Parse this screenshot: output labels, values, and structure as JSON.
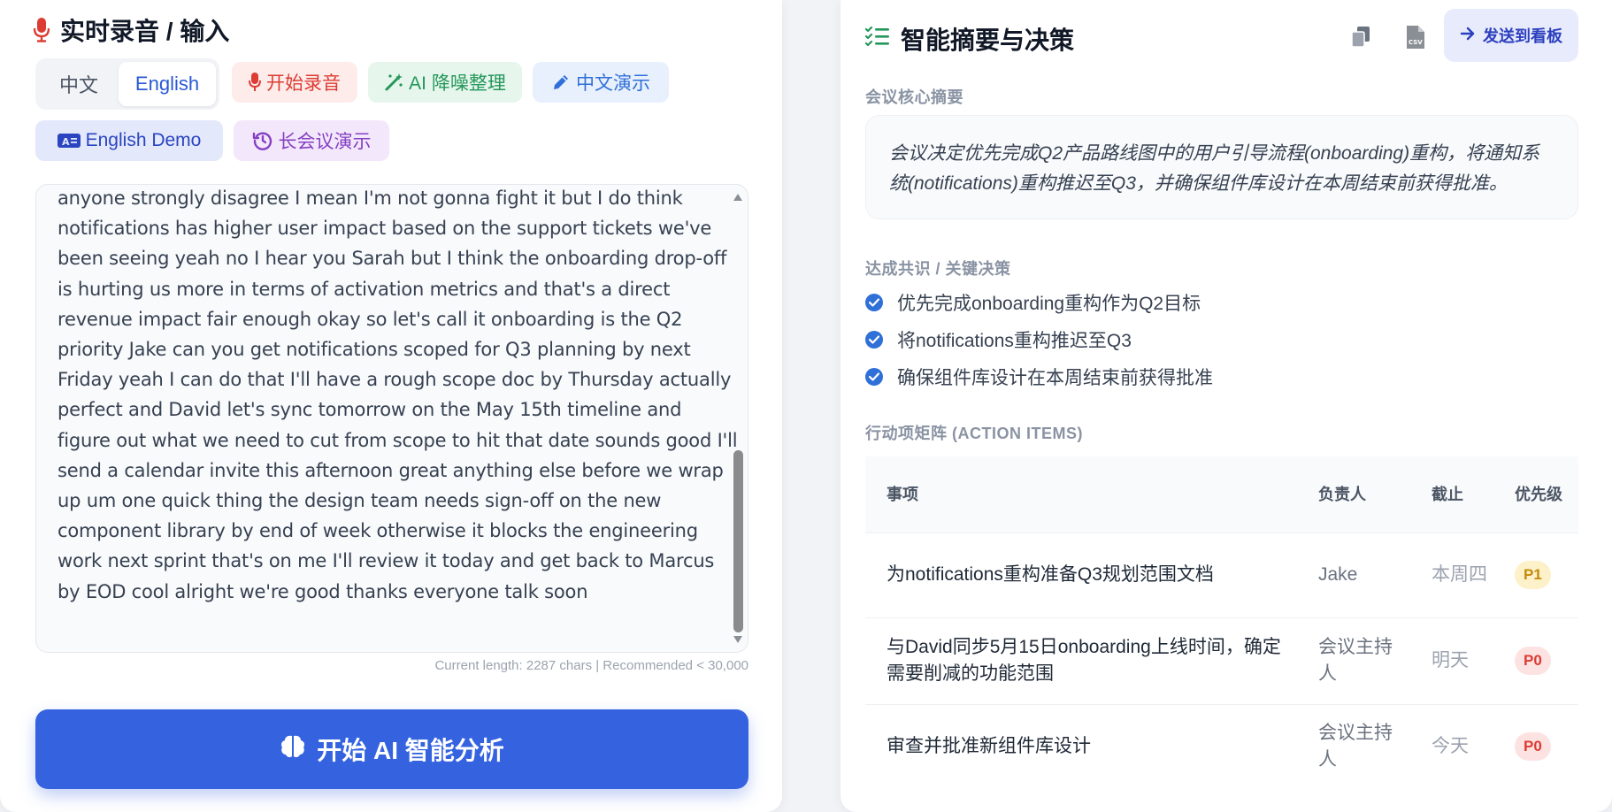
{
  "left": {
    "title": "实时录音 / 输入",
    "lang_toggle": {
      "zh": "中文",
      "en": "English",
      "selected": "English"
    },
    "buttons": {
      "record": "开始录音",
      "denoise": "AI 降噪整理",
      "zh_demo": "中文演示",
      "en_demo": "English Demo",
      "long_demo": "长会议演示"
    },
    "transcript": "anyone strongly disagree I mean I'm not gonna fight it but I do think notifications has higher user impact based on the support tickets we've been seeing yeah no I hear you Sarah but I think the onboarding drop-off is hurting us more in terms of activation metrics and that's a direct revenue impact fair enough okay so let's call it onboarding is the Q2 priority Jake can you get notifications scoped for Q3 planning by next Friday yeah I can do that I'll have a rough scope doc by Thursday actually perfect and David let's sync tomorrow on the May 15th timeline and figure out what we need to cut from scope to hit that date sounds good I'll send a calendar invite this afternoon great anything else before we wrap up um one quick thing the design team needs sign-off on the new component library by end of week otherwise it blocks the engineering work next sprint that's on me I'll review it today and get back to Marcus by EOD cool alright we're good thanks everyone talk soon",
    "char_count": "Current length: 2287 chars | Recommended < 30,000",
    "analyze_button": "开始 AI 智能分析"
  },
  "right": {
    "title": "智能摘要与决策",
    "send_button": "发送到看板",
    "summary_label": "会议核心摘要",
    "summary_text": "会议决定优先完成Q2产品路线图中的用户引导流程(onboarding)重构，将通知系统(notifications)重构推迟至Q3，并确保组件库设计在本周结束前获得批准。",
    "decisions_label": "达成共识 / 关键决策",
    "decisions": [
      "优先完成onboarding重构作为Q2目标",
      "将notifications重构推迟至Q3",
      "确保组件库设计在本周结束前获得批准"
    ],
    "actions_label": "行动项矩阵 (ACTION ITEMS)",
    "table": {
      "headers": {
        "item": "事项",
        "owner": "负责人",
        "due": "截止",
        "priority": "优先级"
      },
      "rows": [
        {
          "item": "为notifications重构准备Q3规划范围文档",
          "owner": "Jake",
          "due": "本周四",
          "priority": "P1"
        },
        {
          "item": "与David同步5月15日onboarding上线时间，确定需要削减的功能范围",
          "owner": "会议主持人",
          "due": "明天",
          "priority": "P0"
        },
        {
          "item": "审查并批准新组件库设计",
          "owner": "会议主持人",
          "due": "今天",
          "priority": "P0"
        }
      ]
    }
  },
  "colors": {
    "primary": "#3563e0",
    "record_red": "#dc3c33",
    "denoise_green": "#24975a",
    "p1": "#c58a0b",
    "p0": "#dc3c33"
  },
  "icons": {
    "title_left": "microphone-icon",
    "title_right": "checklist-icon",
    "record": "microphone-icon",
    "denoise": "magic-wand-icon",
    "zh_demo": "pen-icon",
    "en_demo": "translate-icon",
    "long_demo": "history-icon",
    "analyze": "brain-icon",
    "copy": "copy-icon",
    "csv": "csv-file-icon",
    "send": "arrow-right-icon",
    "check": "check-circle-icon"
  }
}
